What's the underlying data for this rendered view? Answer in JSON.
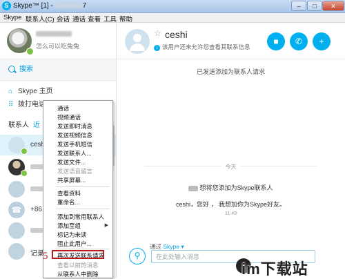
{
  "window": {
    "title": "Skype™ [1] - ",
    "title_blur": "7",
    "buttons": [
      "–",
      "□",
      "✕"
    ]
  },
  "menu": [
    "Skype",
    "联系人(C)",
    "会话",
    "通话",
    "查看",
    "工具",
    "帮助"
  ],
  "profile": {
    "mood": "怎么可以吃兔兔"
  },
  "search": {
    "placeholder": "搜索"
  },
  "nav": [
    {
      "icon": "home-icon",
      "glyph": "⌂",
      "label": "Skype 主页"
    },
    {
      "icon": "dialpad-icon",
      "glyph": "⠿",
      "label": "拨打电话"
    }
  ],
  "contacts_header": {
    "label": "联系人",
    "recent": "近"
  },
  "contacts": [
    {
      "name": "ceshi",
      "selected": true
    },
    {
      "name": ""
    },
    {
      "name": ""
    },
    {
      "name": "+86"
    },
    {
      "name": ""
    },
    {
      "name": "记录"
    }
  ],
  "context_menu": {
    "items": [
      "通话",
      "视频通话",
      "发送即时消息",
      "发送视频信息",
      "发送手机短信",
      "发送联系人...",
      "发送文件...",
      "发送语音留言",
      "共享屏幕...",
      "查看资料",
      "重命名...",
      "添加到常用联系人",
      "添加至组",
      "标记为未读",
      "阻止此用户...",
      "再次发送联系请求",
      "查看以前的消息",
      "从联系人中删除"
    ],
    "disabled": [
      "发送语音留言",
      "查看以前的消息"
    ],
    "highlighted": "再次发送联系请求",
    "step": "5"
  },
  "chat": {
    "contact_name": "ceshi",
    "info": "该用户还未允许您查看其联系信息",
    "system_message": "已发送添加为联系人请求",
    "divider": "今天",
    "request_text": "想将您添加为Skype联系人",
    "hello_text": "ceshi，您好 ， 我想加你为Skype好友。",
    "time": "11:49",
    "via_label": "通过",
    "via_link": "Skype ▾",
    "input_placeholder": "在此处输入消息"
  },
  "watermark": {
    "circle": "i",
    "text": "im下载站"
  },
  "colors": {
    "accent": "#00aff0",
    "highlight_box": "#b71c1c",
    "online": "#7dc242"
  }
}
